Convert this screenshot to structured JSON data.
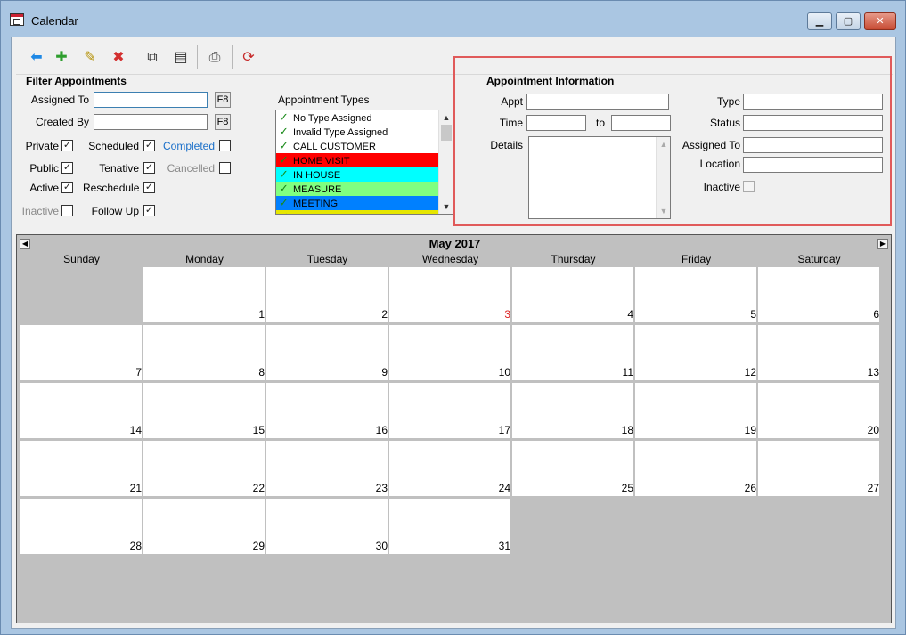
{
  "window": {
    "title": "Calendar",
    "min": "▁",
    "max": "▢",
    "close": "✕"
  },
  "toolbar": [
    {
      "icon": "back-arrow-icon",
      "glyph": "⬅",
      "color": "#1e88e5"
    },
    {
      "icon": "new-icon",
      "glyph": "✚",
      "color": "#2e9e2e"
    },
    {
      "icon": "edit-icon",
      "glyph": "✎",
      "color": "#b38f00"
    },
    {
      "icon": "delete-icon",
      "glyph": "✖",
      "color": "#d32f2f"
    },
    {
      "icon": "copy-icon",
      "glyph": "⧉",
      "color": "#333333"
    },
    {
      "icon": "paste-icon",
      "glyph": "▤",
      "color": "#333333"
    },
    {
      "icon": "print-icon",
      "glyph": "⎙",
      "color": "#444444"
    },
    {
      "icon": "refresh-icon",
      "glyph": "⟳",
      "color": "#c62828"
    }
  ],
  "filter": {
    "title": "Filter Appointments",
    "assigned_to_label": "Assigned To",
    "assigned_to_value": "",
    "created_by_label": "Created By",
    "created_by_value": "",
    "f8": "F8",
    "checks": {
      "private": {
        "label": "Private",
        "checked": "✓"
      },
      "public": {
        "label": "Public",
        "checked": "✓"
      },
      "active": {
        "label": "Active",
        "checked": "✓"
      },
      "inactive": {
        "label": "Inactive",
        "checked": ""
      },
      "scheduled": {
        "label": "Scheduled",
        "checked": "✓"
      },
      "tenative": {
        "label": "Tenative",
        "checked": "✓"
      },
      "reschedule": {
        "label": "Reschedule",
        "checked": "✓"
      },
      "follow_up": {
        "label": "Follow Up",
        "checked": "✓"
      },
      "completed": {
        "label": "Completed",
        "checked": ""
      },
      "cancelled": {
        "label": "Cancelled",
        "checked": ""
      }
    },
    "types_label": "Appointment Types",
    "types": [
      {
        "label": "No Type Assigned",
        "bg": "#ffffff"
      },
      {
        "label": "Invalid Type Assigned",
        "bg": "#ffffff"
      },
      {
        "label": "CALL CUSTOMER",
        "bg": "#ffffff"
      },
      {
        "label": "HOME VISIT",
        "bg": "#ff0000"
      },
      {
        "label": "IN HOUSE",
        "bg": "#00ffff"
      },
      {
        "label": "MEASURE",
        "bg": "#80ff80"
      },
      {
        "label": "MEETING",
        "bg": "#0080ff"
      },
      {
        "label": "",
        "bg": "#e6e600"
      }
    ]
  },
  "appt": {
    "title": "Appointment Information",
    "appt_label": "Appt",
    "appt_value": "",
    "time_label": "Time",
    "time_from": "",
    "to_label": "to",
    "time_to": "",
    "details_label": "Details",
    "details_value": "",
    "type_label": "Type",
    "type_value": "",
    "status_label": "Status",
    "status_value": "",
    "assigned_label": "Assigned To",
    "assigned_value": "",
    "location_label": "Location",
    "location_value": "",
    "inactive_label": "Inactive"
  },
  "calendar": {
    "month": "May 2017",
    "prev": "◀",
    "next": "▶",
    "days": [
      "Sunday",
      "Monday",
      "Tuesday",
      "Wednesday",
      "Thursday",
      "Friday",
      "Saturday"
    ],
    "first_weekday": 1,
    "num_days": 31,
    "highlight_day": "3"
  }
}
